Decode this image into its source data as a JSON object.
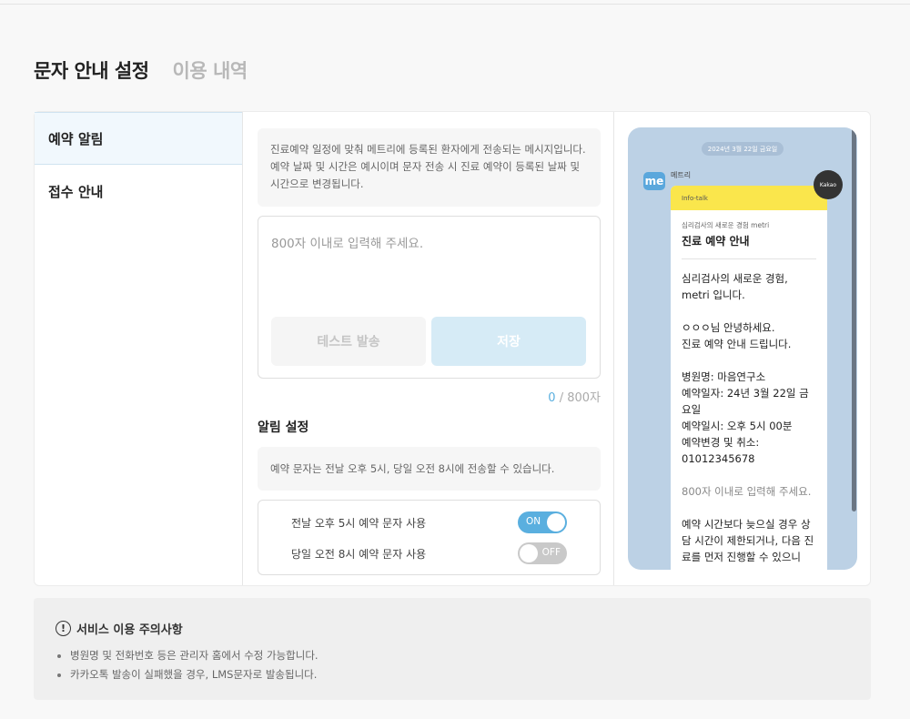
{
  "tabs": [
    {
      "label": "문자 안내 설정",
      "active": true
    },
    {
      "label": "이용 내역",
      "active": false
    }
  ],
  "sidebar": {
    "items": [
      {
        "label": "예약 알림",
        "active": true
      },
      {
        "label": "접수 안내",
        "active": false
      }
    ]
  },
  "editor": {
    "description": "진료예약 일정에 맞춰 메트리에 등록된 환자에게 전송되는 메시지입니다. 예약 날짜 및 시간은 예시이며 문자 전송 시 진료 예약이 등록된 날짜 및 시간으로 변경됩니다.",
    "placeholder": "800자 이내로 입력해 주세요.",
    "value": "",
    "test_button": "테스트 발송",
    "save_button": "저장",
    "count_current": "0",
    "count_max": " / 800자"
  },
  "alarm": {
    "title": "알림 설정",
    "note": "예약 문자는 전날 오후 5시, 당일 오전 8시에 전송할 수 있습니다.",
    "toggles": [
      {
        "label": "전날 오후 5시 예약 문자 사용",
        "state": "ON"
      },
      {
        "label": "당일 오전 8시 예약 문자 사용",
        "state": "OFF"
      }
    ]
  },
  "preview": {
    "date": "2024년 3월 22일 금요일",
    "logo_text": "me",
    "sender": "메트리",
    "profile_label": "Kakao",
    "header": "Info-talk",
    "subtitle": "심리검사의 새로운 경험 metri",
    "title": "진료 예약 안내",
    "body": "심리검사의 새로운 경험,\nmetri 입니다.\n\nㅇㅇㅇ님 안녕하세요.\n진료 예약 안내 드립니다.\n\n병원명: 마음연구소\n예약일자: 24년 3월 22일 금요일\n예약일시: 오후 5시 00분\n예약변경 및 취소:\n01012345678\n\n",
    "placeholder_line": "800자 이내로 입력해 주세요.",
    "footer": "\n\n예약 시간보다 늦으실 경우 상담 시간이 제한되거나, 다음 진료를 먼저 진행할 수 있으니"
  },
  "notice": {
    "title": "서비스 이용 주의사항",
    "items": [
      "병원명 및 전화번호 등은 관리자 홈에서 수정 가능합니다.",
      "카카오톡 발송이 실패했을 경우, LMS문자로 발송됩니다."
    ]
  },
  "colors": {
    "accent": "#5aafdf",
    "save_disabled": "#d6ebf6",
    "kakao_yellow": "#fae64c",
    "phone_bg": "#bcd1e5"
  }
}
